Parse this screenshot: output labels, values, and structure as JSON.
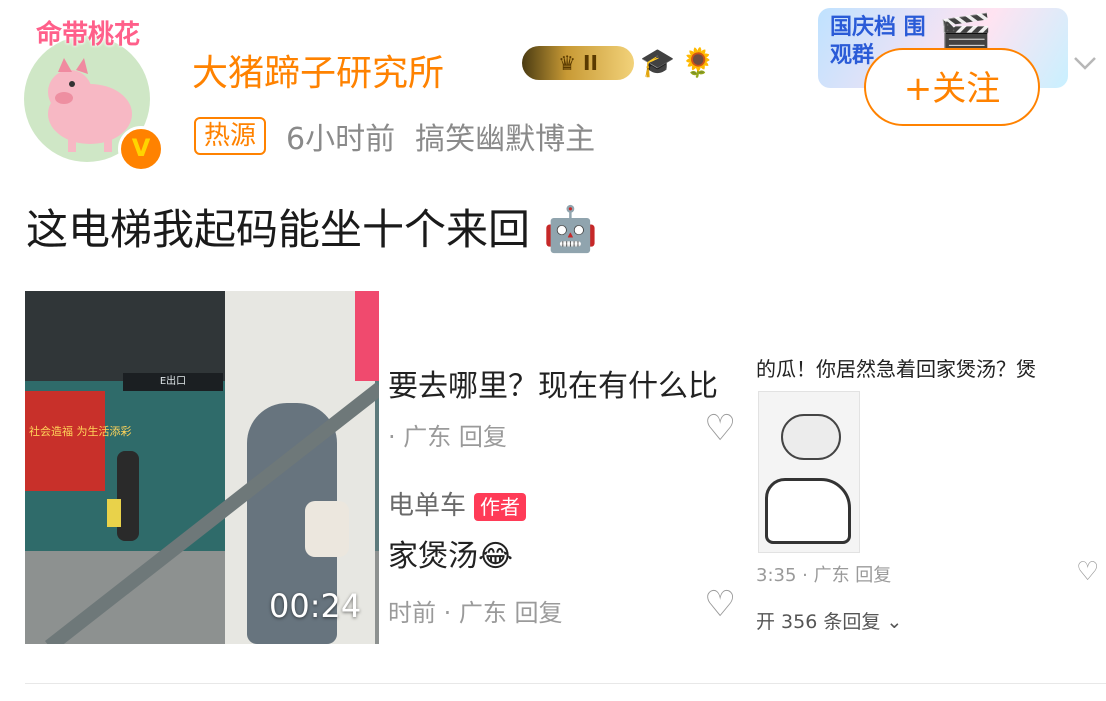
{
  "header": {
    "avatar_frame_text": "命带桃花",
    "verified_mark": "V",
    "username": "大猪蹄子研究所",
    "vip_level": "II",
    "badge_emojis": [
      "🎓",
      "🌻"
    ],
    "hot_tag": "热源",
    "time": "6小时前",
    "category": "搞笑幽默博主",
    "event_badge": "国庆档 围观群",
    "event_mascot": "🎬",
    "follow_label": "+关注",
    "more_icon": "chevron-down-icon"
  },
  "post": {
    "text": "这电梯我起码能坐十个来回",
    "emoji": "🤖"
  },
  "media": {
    "video": {
      "duration": "00:24",
      "board_text": "社会造福 为生活添彩",
      "sign_text": "E出口"
    },
    "comments": {
      "line1": "要去哪里？现在有什么比",
      "meta1": "· 广东    回复",
      "name2": "电单车",
      "author_tag": "作者",
      "line2": "家煲汤😂",
      "meta2": "时前 · 广东    回复"
    },
    "thread": {
      "line1": "的瓜！你居然急着回家煲汤？煲",
      "meta": "3:35 · 广东    回复",
      "expand": "开 356 条回复 ⌄"
    }
  },
  "colors": {
    "accent": "#ff8200",
    "meta_text": "#8a8a8a",
    "author_tag": "#ff3b57"
  }
}
